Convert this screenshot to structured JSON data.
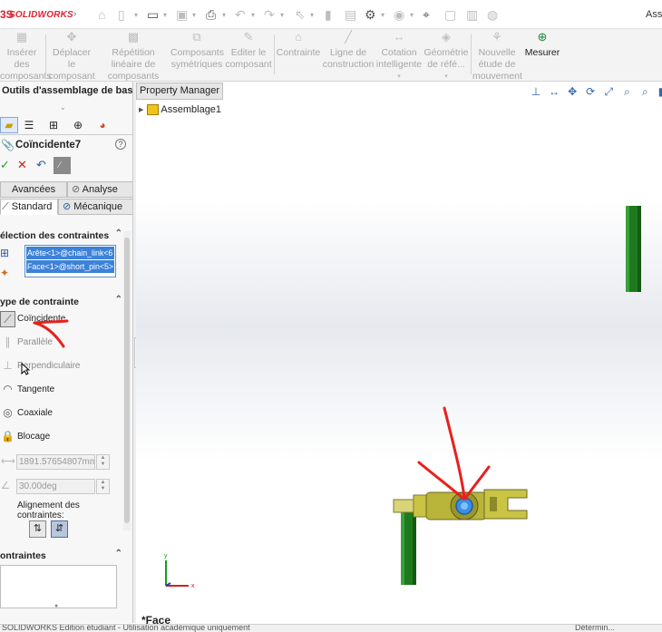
{
  "app": {
    "brand_prefix": "3S",
    "brand": "SOLIDWORKS",
    "title_right": "Asse"
  },
  "toolbar": {
    "commands": [
      {
        "label": "Insérer des composants",
        "icon": "insert-components-icon"
      },
      {
        "label": "Déplacer le composant",
        "icon": "move-component-icon"
      },
      {
        "label": "Répétition linéaire de composants",
        "icon": "linear-pattern-icon"
      },
      {
        "label": "Composants symétriques",
        "icon": "mirror-components-icon"
      },
      {
        "label": "Editer le composant",
        "icon": "edit-component-icon"
      },
      {
        "label": "Contrainte",
        "icon": "mate-icon"
      },
      {
        "label": "Ligne de construction",
        "icon": "construction-line-icon"
      },
      {
        "label": "Cotation intelligente",
        "icon": "smart-dimension-icon"
      },
      {
        "label": "Géométrie de réfé...",
        "icon": "reference-geometry-icon"
      },
      {
        "label": "Nouvelle étude de mouvement",
        "icon": "motion-study-icon"
      },
      {
        "label": "Mesurer",
        "icon": "measure-icon"
      }
    ]
  },
  "panel": {
    "title": "Outils d'assemblage de base",
    "mate_name": "Coïncidente7",
    "tabs": {
      "advanced": "Avancées",
      "analysis": "Analyse",
      "standard": "Standard",
      "mechanical": "Mécanique"
    },
    "selection_header": "élection des contraintes",
    "selections": [
      "Arête<1>@chain_link<6",
      "Face<1>@short_pin<5>"
    ],
    "type_header": "ype de contrainte",
    "mates": [
      {
        "label": "Coïncidente",
        "icon": "coincident-icon"
      },
      {
        "label": "Parallèle",
        "icon": "parallel-icon"
      },
      {
        "label": "Perpendiculaire",
        "icon": "perpendicular-icon"
      },
      {
        "label": "Tangente",
        "icon": "tangent-icon"
      },
      {
        "label": "Coaxiale",
        "icon": "concentric-icon"
      },
      {
        "label": "Blocage",
        "icon": "lock-icon"
      }
    ],
    "distance_value": "1891.57654807mm",
    "angle_value": "30.00deg",
    "alignment_label": "Alignement des contraintes:",
    "constraints_header": "ontraintes"
  },
  "viewport": {
    "tab_label": "Property Manager",
    "tree_root": "Assemblage1",
    "status_text": "*Face"
  },
  "colors": {
    "accent": "#3c82d8",
    "annotation": "#e8201e",
    "part_green": "#1e7a1e",
    "part_olive": "#c9c444"
  },
  "statusbar": {
    "left": "SOLIDWORKS Edition étudiant - Utilisation académique uniquement",
    "right": "Détermin..."
  }
}
